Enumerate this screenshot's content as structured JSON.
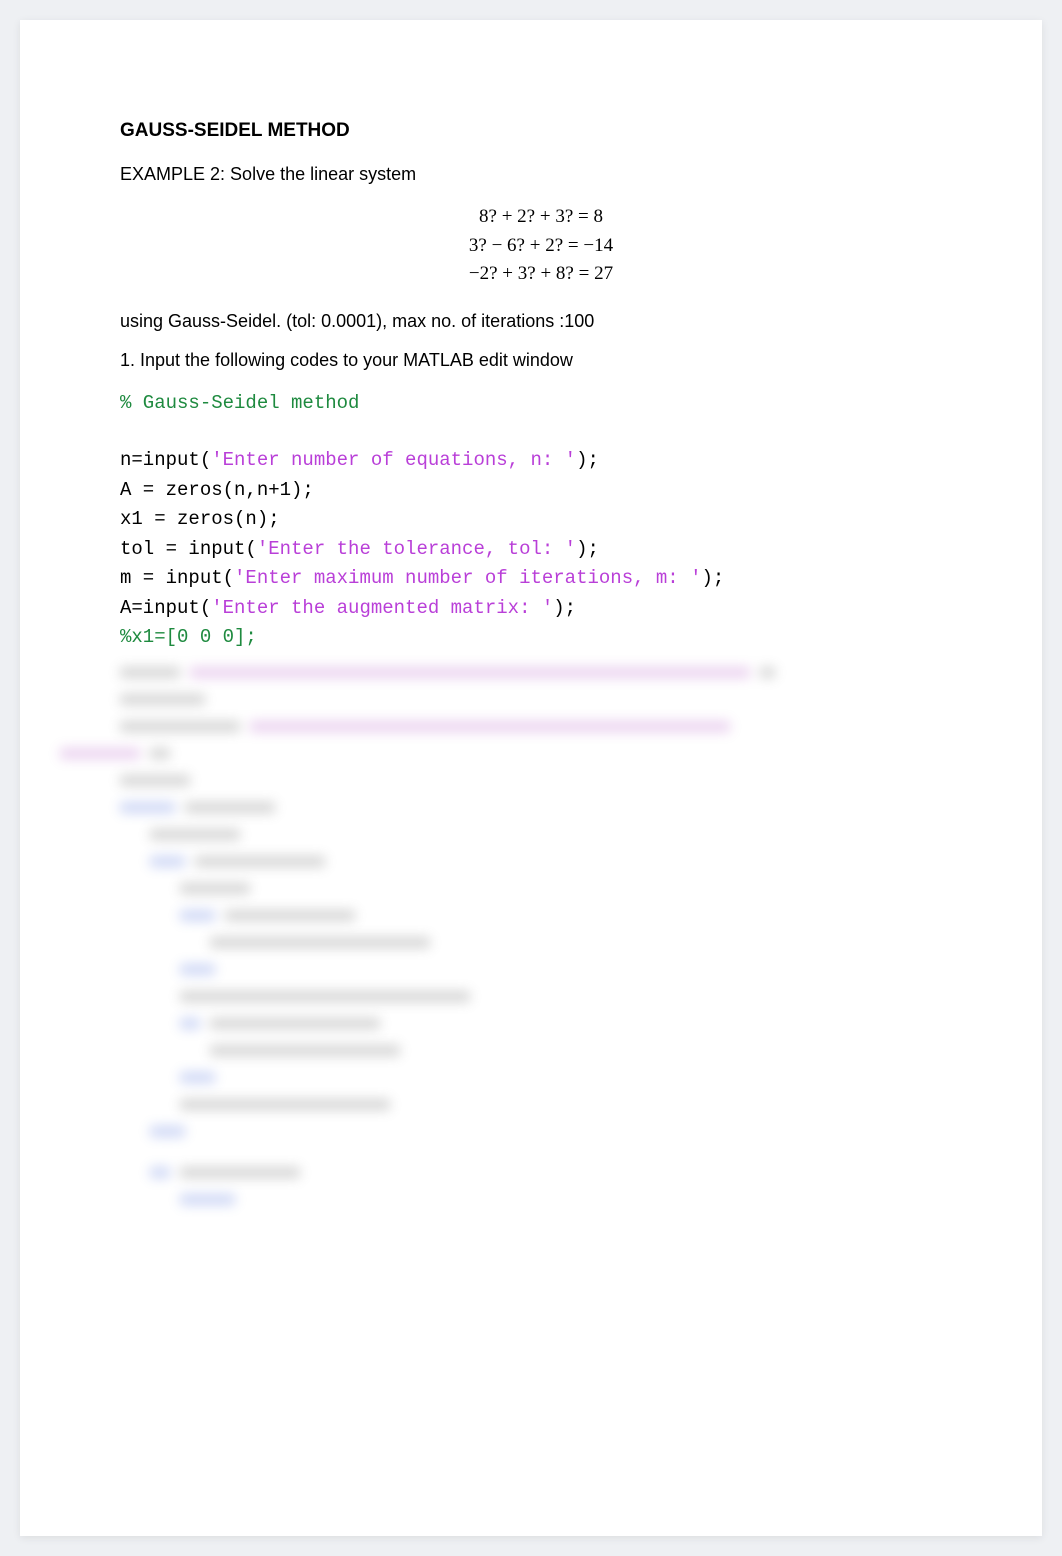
{
  "heading": "GAUSS-SEIDEL METHOD",
  "example_label": "EXAMPLE 2: Solve the linear system",
  "equations": {
    "line1": "8? + 2? + 3? = 8",
    "line2": "3? − 6? + 2? = −14",
    "line3": "−2? + 3? + 8? = 27"
  },
  "using_line": "using Gauss-Seidel. (tol: 0.0001), max no. of iterations :100",
  "step1": "1. Input the following codes to your MATLAB edit window",
  "code": {
    "c0": "% Gauss-Seidel method",
    "l1_pre": " n=input(",
    "l1_str": "'Enter number of equations, n:  '",
    "l1_post": ");",
    "l2": " A = zeros(n,n+1);",
    "l3": " x1 = zeros(n);",
    "l4_pre": " tol = input(",
    "l4_str": "'Enter the tolerance, tol: '",
    "l4_post": ");",
    "l5_pre": " m = input(",
    "l5_str": "'Enter maximum number of iterations, m:  '",
    "l5_post": ");",
    "l6_pre": " A=input(",
    "l6_str": "'Enter the augmented matrix: '",
    "l6_post": ");",
    "l7": " %x1=[0 0 0];"
  }
}
